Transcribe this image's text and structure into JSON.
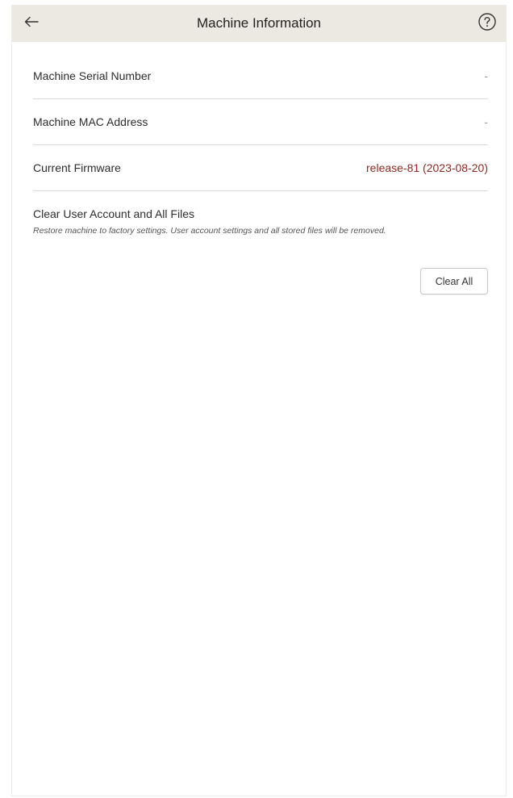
{
  "header": {
    "title": "Machine Information",
    "back_icon": "arrow-left-icon",
    "help_icon": "question-circle-icon",
    "background_color": "#ece8e2"
  },
  "info_rows": [
    {
      "label": "Machine Serial Number",
      "value": "-"
    },
    {
      "label": "Machine MAC Address",
      "value": "-"
    },
    {
      "label": "Current Firmware",
      "value": "release-81 (2023-08-20)"
    }
  ],
  "clear_section": {
    "title": "Clear User Account and All Files",
    "description": "Restore machine to factory settings. User account settings and all stored files will be removed.",
    "button_label": "Clear All"
  },
  "colors": {
    "firmware_value": "#8b2b22",
    "divider": "#d9d9d9"
  }
}
